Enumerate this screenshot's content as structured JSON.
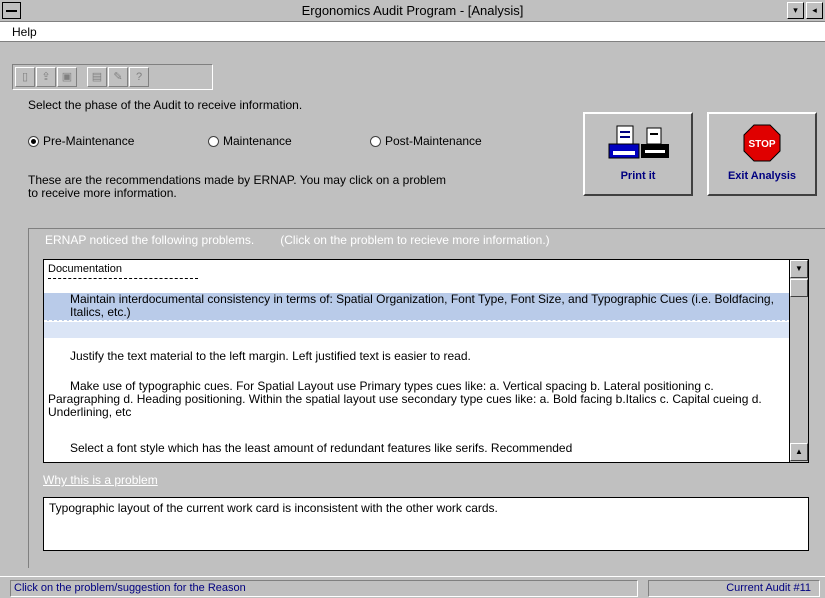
{
  "window": {
    "title": "Ergonomics Audit Program - [Analysis]",
    "minimize_glyph": "▾",
    "restore_glyph": "◂"
  },
  "menu": {
    "items": [
      "Help"
    ]
  },
  "toolbar": {
    "icons": [
      "new-icon",
      "open-icon",
      "save-icon",
      "print-preview-icon",
      "edit-icon",
      "help-icon"
    ],
    "help_glyph": "?"
  },
  "phase": {
    "prompt": "Select the phase of the Audit to receive information.",
    "options": [
      "Pre-Maintenance",
      "Maintenance",
      "Post-Maintenance"
    ],
    "selected": "Pre-Maintenance"
  },
  "recommendations_intro": "These are the recommendations made by ERNAP. You may click on a problem to receive more information.",
  "buttons": {
    "print": "Print it",
    "exit": "Exit Analysis",
    "stop_sign_text": "STOP"
  },
  "problems": {
    "title": "ERNAP noticed the following problems.",
    "hint": "(Click on the problem to recieve more information.)",
    "category": "Documentation",
    "items": [
      "Maintain interdocumental consistency in terms of: Spatial Organization, Font Type, Font Size, and Typographic Cues (i.e. Boldfacing, Italics, etc.)",
      "Justify the text material to the left margin. Left justified text is easier to read.",
      "Make use of typographic cues. For Spatial Layout use Primary types cues like: a. Vertical spacing b. Lateral positioning  c. Paragraphing d. Heading positioning. Within the spatial layout use secondary type cues like: a. Bold facing b.Italics c. Capital cueing d. Underlining, etc",
      "Select a font style which has the least amount of redundant features like serifs. Recommended"
    ],
    "selected_index": 0
  },
  "why": {
    "label": "Why this is a problem",
    "text": "Typographic layout of the current work card is inconsistent with the other work  cards."
  },
  "status": {
    "message": "Click on the problem/suggestion for the Reason",
    "audit": "Current Audit #11"
  },
  "colors": {
    "face": "#c0c0c0",
    "selection": "#b9cbe9",
    "status_text": "#000080",
    "stop_red": "#e00000"
  }
}
